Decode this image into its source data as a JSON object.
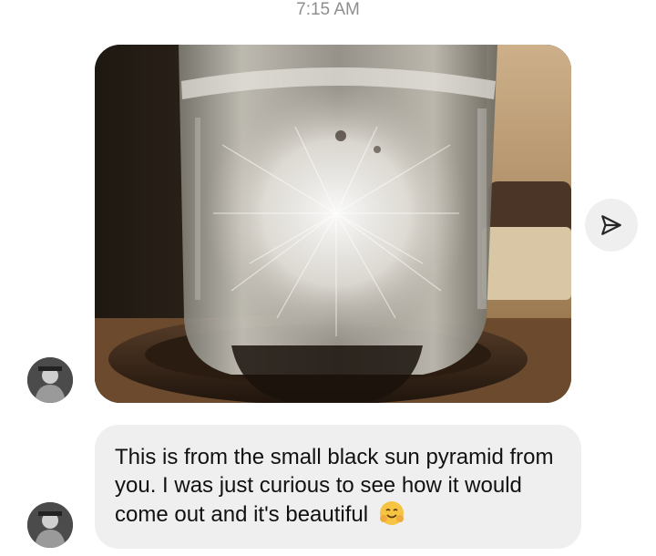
{
  "thread": {
    "timestamp": "7:15 AM"
  },
  "photo_message": {
    "sender": "other",
    "content": "photo"
  },
  "share": {
    "icon": "paper-plane-icon"
  },
  "text_message": {
    "sender": "other",
    "text": "This is from the small black sun pyramid from you. I was just curious to see how it would come out and it's beautiful",
    "emoji": "🤗",
    "emoji_name": "hugging-face-emoji"
  },
  "colors": {
    "bubble_bg": "#efefef",
    "timestamp": "#8e8e8e",
    "text": "#111111"
  }
}
